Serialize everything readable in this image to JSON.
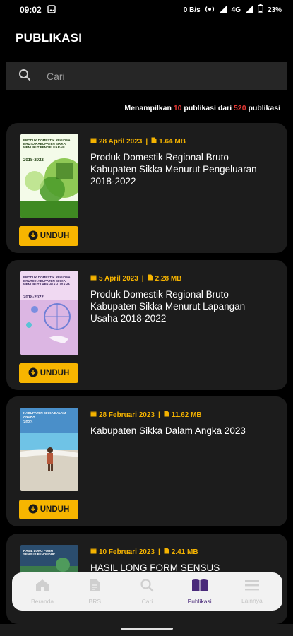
{
  "status_bar": {
    "time": "09:02",
    "net_speed": "0 B/s",
    "network": "4G",
    "battery": "23%"
  },
  "header": {
    "title": "PUBLIKASI"
  },
  "search": {
    "placeholder": "Cari"
  },
  "results": {
    "prefix": "Menampilkan",
    "shown": "10",
    "middle": "publikasi dari",
    "total": "520",
    "suffix": "publikasi"
  },
  "publications": [
    {
      "date": "28 April 2023",
      "size": "1.64 MB",
      "title": "Produk Domestik Regional Bruto Kabupaten Sikka Menurut Pengeluaran 2018-2022",
      "cover_text": "PRODUK DOMESTIK REGIONAL BRUTO KABUPATEN SIKKA MENURUT PENGELUARAN",
      "cover_year": "2018-2022"
    },
    {
      "date": "5 April 2023",
      "size": "2.28 MB",
      "title": "Produk Domestik Regional Bruto Kabupaten Sikka Menurut Lapangan Usaha 2018-2022",
      "cover_text": "PRODUK DOMESTIK REGIONAL BRUTO KABUPATEN SIKKA MENURUT LAPANGAN USAHA",
      "cover_year": "2018-2022"
    },
    {
      "date": "28 Februari 2023",
      "size": "11.62 MB",
      "title": "Kabupaten Sikka Dalam Angka 2023",
      "cover_text": "KABUPATEN SIKKA DALAM ANGKA",
      "cover_year": "2023"
    },
    {
      "date": "10 Februari 2023",
      "size": "2.41 MB",
      "title": "HASIL LONG FORM SENSUS PENDUDUK",
      "cover_text": "HASIL LONG FORM SENSUS PENDUDUK",
      "cover_year": ""
    }
  ],
  "download_label": "UNDUH",
  "bottom_nav": [
    {
      "label": "Beranda",
      "icon": "home-icon",
      "active": false
    },
    {
      "label": "BRS",
      "icon": "document-icon",
      "active": false
    },
    {
      "label": "Cari",
      "icon": "search-icon",
      "active": false
    },
    {
      "label": "Publikasi",
      "icon": "book-icon",
      "active": true
    },
    {
      "label": "Lainnya",
      "icon": "menu-icon",
      "active": false
    }
  ],
  "colors": {
    "accent": "#f7b500",
    "count_highlight": "#e53935",
    "active_nav": "#4a2a7a"
  }
}
